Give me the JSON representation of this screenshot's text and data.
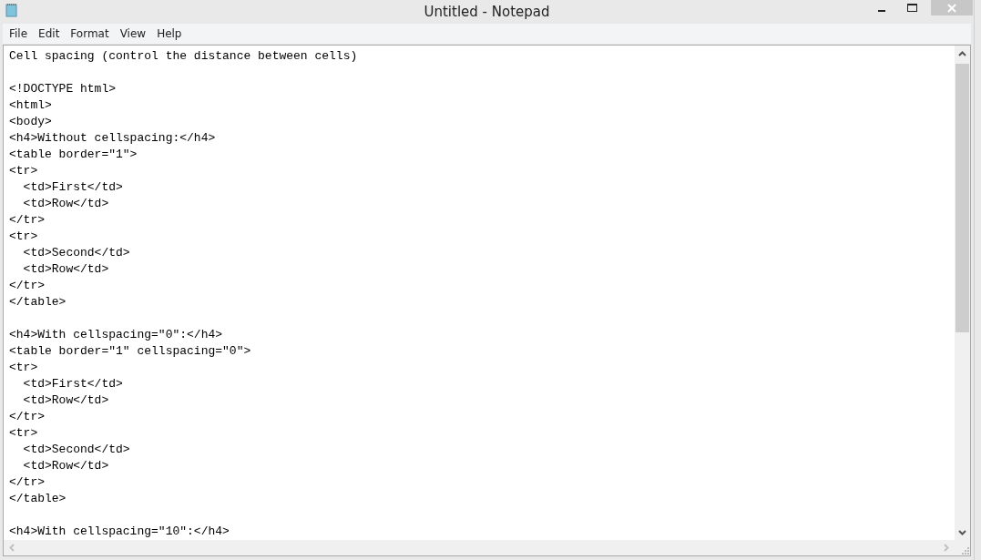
{
  "window": {
    "title": "Untitled - Notepad"
  },
  "menu": [
    "File",
    "Edit",
    "Format",
    "View",
    "Help"
  ],
  "editor": {
    "text": "Cell spacing (control the distance between cells)\n\n<!DOCTYPE html>\n<html>\n<body>\n<h4>Without cellspacing:</h4>\n<table border=\"1\">\n<tr>\n  <td>First</td>\n  <td>Row</td>\n</tr>\n<tr>\n  <td>Second</td>\n  <td>Row</td>\n</tr>\n</table>\n\n<h4>With cellspacing=\"0\":</h4>\n<table border=\"1\" cellspacing=\"0\">\n<tr>\n  <td>First</td>\n  <td>Row</td>\n</tr>\n<tr>\n  <td>Second</td>\n  <td>Row</td>\n</tr>\n</table>\n\n<h4>With cellspacing=\"10\":</h4>"
  }
}
